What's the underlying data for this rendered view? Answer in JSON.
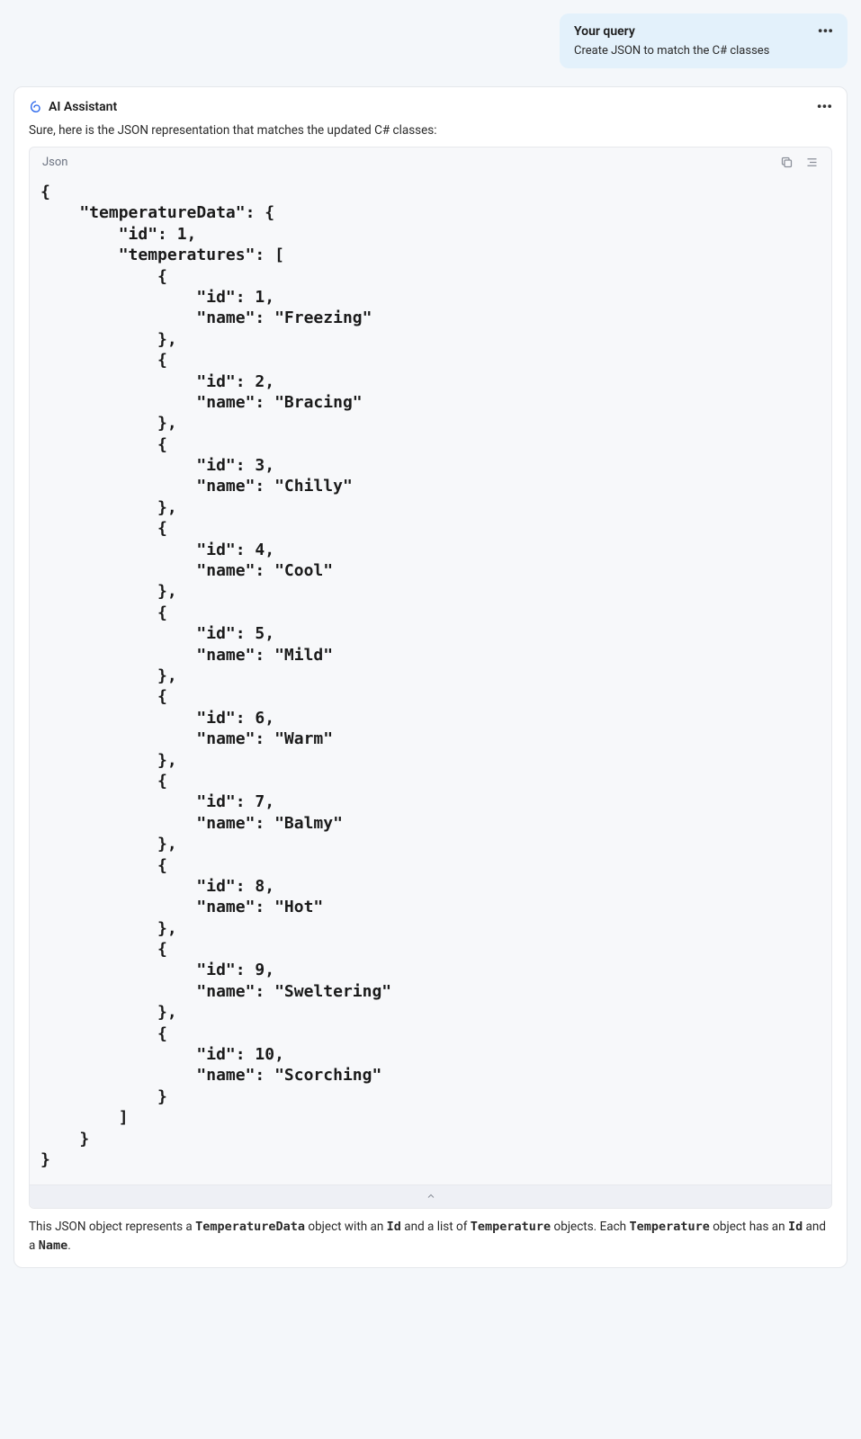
{
  "query": {
    "label": "Your query",
    "text": "Create JSON to match the C# classes"
  },
  "assistant": {
    "title": "AI Assistant",
    "intro": "Sure, here is the JSON representation that matches the updated C# classes:",
    "code_lang": "Json",
    "code": "{\n    \"temperatureData\": {\n        \"id\": 1,\n        \"temperatures\": [\n            {\n                \"id\": 1,\n                \"name\": \"Freezing\"\n            },\n            {\n                \"id\": 2,\n                \"name\": \"Bracing\"\n            },\n            {\n                \"id\": 3,\n                \"name\": \"Chilly\"\n            },\n            {\n                \"id\": 4,\n                \"name\": \"Cool\"\n            },\n            {\n                \"id\": 5,\n                \"name\": \"Mild\"\n            },\n            {\n                \"id\": 6,\n                \"name\": \"Warm\"\n            },\n            {\n                \"id\": 7,\n                \"name\": \"Balmy\"\n            },\n            {\n                \"id\": 8,\n                \"name\": \"Hot\"\n            },\n            {\n                \"id\": 9,\n                \"name\": \"Sweltering\"\n            },\n            {\n                \"id\": 10,\n                \"name\": \"Scorching\"\n            }\n        ]\n    }\n}",
    "footer_parts": {
      "t1": "This JSON object represents a ",
      "c1": "TemperatureData",
      "t2": " object with an ",
      "c2": "Id",
      "t3": " and a list of ",
      "c3": "Temperature",
      "t4": " objects. Each ",
      "c4": "Temperature",
      "t5": " object has an ",
      "c5": "Id",
      "t6": " and a ",
      "c6": "Name",
      "t7": "."
    }
  }
}
